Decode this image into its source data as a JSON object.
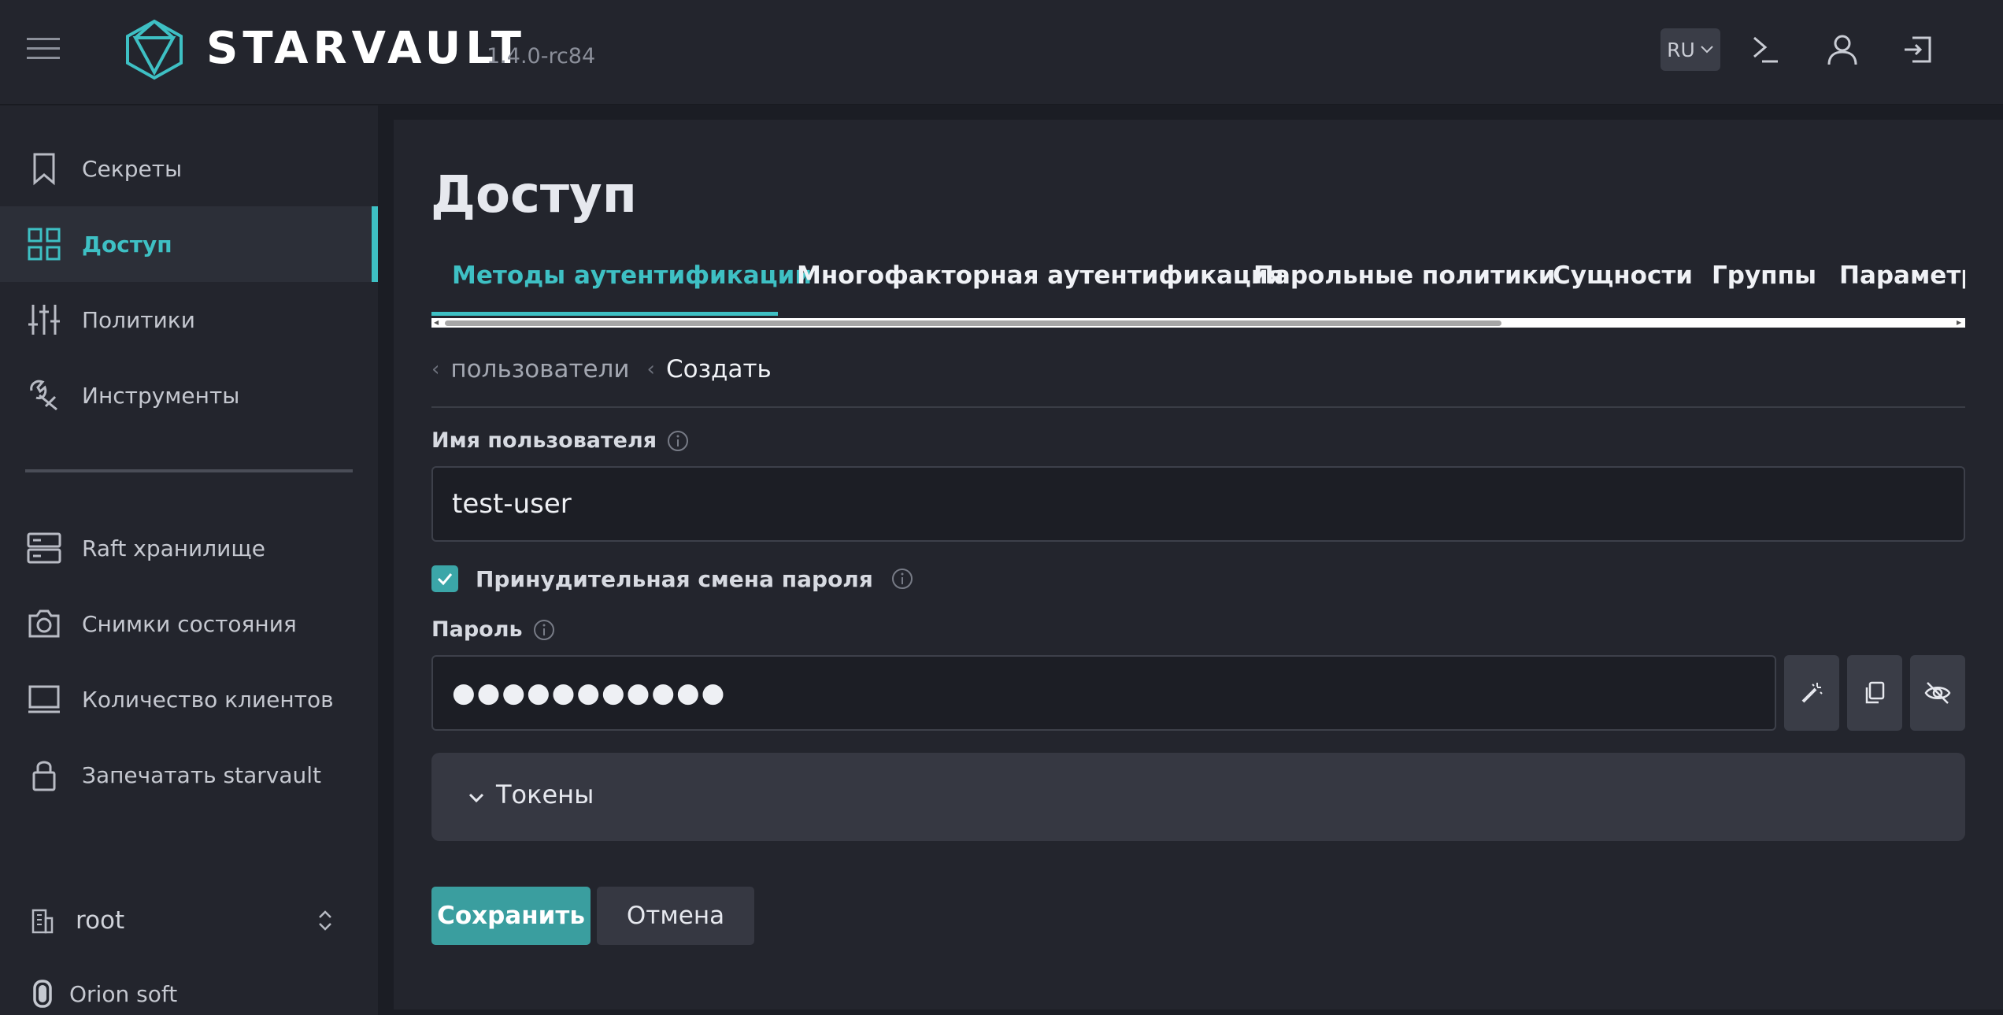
{
  "header": {
    "logo_text": "STARVAULT",
    "version": "1.4.0-rc84",
    "language": "RU",
    "icons": [
      "menu-icon",
      "starvault-logo-icon",
      "terminal-icon",
      "user-icon",
      "logout-icon"
    ]
  },
  "sidebar": {
    "items": [
      {
        "label": "Секреты",
        "icon": "bookmark-icon"
      },
      {
        "label": "Доступ",
        "icon": "grid-icon",
        "active": true
      },
      {
        "label": "Политики",
        "icon": "sliders-icon"
      },
      {
        "label": "Инструменты",
        "icon": "tools-icon"
      },
      {
        "label": "Raft хранилище",
        "icon": "server-icon"
      },
      {
        "label": "Снимки состояния",
        "icon": "camera-icon"
      },
      {
        "label": "Количество клиентов",
        "icon": "monitor-icon"
      },
      {
        "label": "Запечатать starvault",
        "icon": "lock-icon"
      }
    ],
    "namespace": "root",
    "vendor": "Orion soft"
  },
  "main": {
    "title": "Доступ",
    "tabs": [
      {
        "label": "Методы аутентификации",
        "active": true
      },
      {
        "label": "Многофакторная аутентификация"
      },
      {
        "label": "Парольные политики"
      },
      {
        "label": "Сущности"
      },
      {
        "label": "Группы"
      },
      {
        "label": "Параметры"
      }
    ],
    "breadcrumb": {
      "parent": "пользователи",
      "current": "Создать"
    },
    "form": {
      "username_label": "Имя пользователя",
      "username_value": "test-user",
      "force_change_label": "Принудительная смена пароля",
      "force_change_checked": true,
      "password_label": "Пароль",
      "password_value": "●●●●●●●●●●●",
      "password_buttons": [
        "magic-wand-icon",
        "copy-icon",
        "eye-off-icon"
      ],
      "tokens_label": "Токены",
      "save_label": "Сохранить",
      "cancel_label": "Отмена"
    }
  },
  "colors": {
    "accent": "#3ec0c4",
    "save_button": "#3a9e9f",
    "background": "#1b1d24",
    "panel": "#23252d"
  }
}
